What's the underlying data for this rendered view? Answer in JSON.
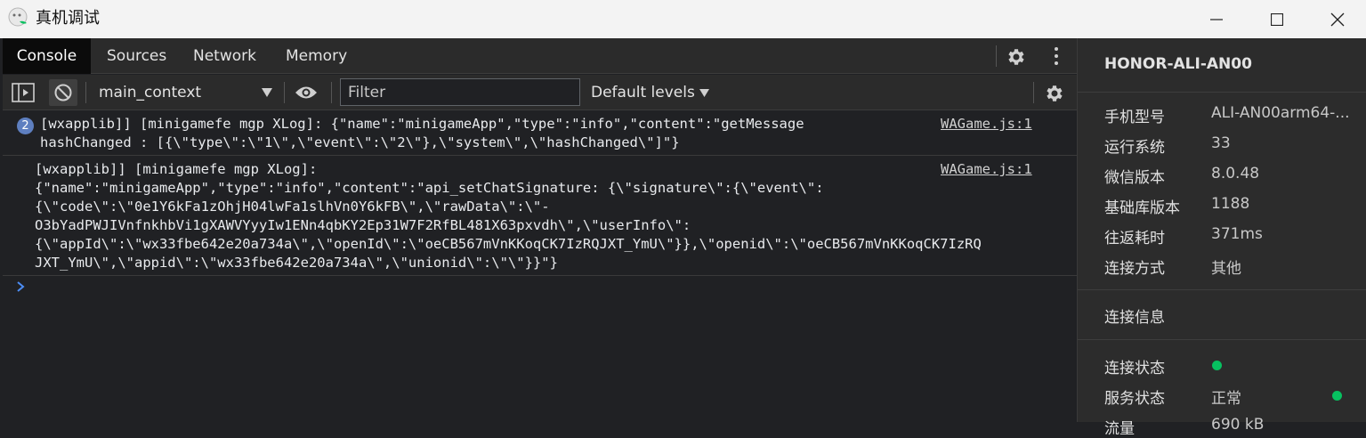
{
  "window": {
    "title": "真机调试"
  },
  "tabs": [
    {
      "label": "Console"
    },
    {
      "label": "Sources"
    },
    {
      "label": "Network"
    },
    {
      "label": "Memory"
    }
  ],
  "toolbar": {
    "context": "main_context",
    "filter_placeholder": "Filter",
    "levels": "Default levels"
  },
  "messages": [
    {
      "count": "2",
      "text": "[wxapplib]] [minigamefe mgp XLog]: {\"name\":\"minigameApp\",\"type\":\"info\",\"content\":\"getMessage\nhashChanged : [{\\\"type\\\":\\\"1\\\",\\\"event\\\":\\\"2\\\"},\\\"system\\\",\\\"hashChanged\\\"]\"}",
      "source": "WAGame.js:1"
    },
    {
      "text": "[wxapplib]] [minigamefe mgp XLog]:\n{\"name\":\"minigameApp\",\"type\":\"info\",\"content\":\"api_setChatSignature: {\\\"signature\\\":{\\\"event\\\":\n{\\\"code\\\":\\\"0e1Y6kFa1zOhjH04lwFa1slhVn0Y6kFB\\\",\\\"rawData\\\":\\\"-\nO3bYadPWJIVnfnkhbVi1gXAWVYyyIw1ENn4qbKY2Ep31W7F2RfBL481X63pxvdh\\\",\\\"userInfo\\\":\n{\\\"appId\\\":\\\"wx33fbe642e20a734a\\\",\\\"openId\\\":\\\"oeCB567mVnKKoqCK7IzRQJXT_YmU\\\"}},\\\"openid\\\":\\\"oeCB567mVnKKoqCK7IzRQ\nJXT_YmU\\\",\\\"appid\\\":\\\"wx33fbe642e20a734a\\\",\\\"unionid\\\":\\\"\\\"}}\"}",
      "source": "WAGame.js:1"
    }
  ],
  "device": {
    "name": "HONOR-ALI-AN00",
    "rows": [
      {
        "label": "手机型号",
        "value": "ALI-AN00arm64-..."
      },
      {
        "label": "运行系统",
        "value": "33"
      },
      {
        "label": "微信版本",
        "value": "8.0.48"
      },
      {
        "label": "基础库版本",
        "value": "1188"
      },
      {
        "label": "往返耗时",
        "value": "371ms"
      },
      {
        "label": "连接方式",
        "value": "其他"
      }
    ],
    "section_title": "连接信息",
    "status_rows": [
      {
        "label": "连接状态",
        "value": ""
      },
      {
        "label": "服务状态",
        "value": "正常"
      },
      {
        "label": "流量",
        "value": "690 kB"
      }
    ],
    "status_color": "#07c160"
  }
}
